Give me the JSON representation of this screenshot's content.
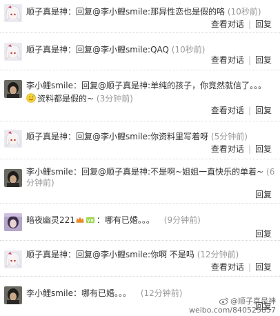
{
  "comments": [
    {
      "author": "顺子真是神",
      "sep": "：",
      "reply_prefix": "回复@李小鲤smile",
      "text": ":那异性恋也是假的咯",
      "time": "(10秒前)",
      "avatar": "anime-girl-avatar",
      "actions": {
        "view": "查看对话",
        "reply": "回复"
      }
    },
    {
      "author": "顺子真是神",
      "sep": "：",
      "reply_prefix": "回复@李小鲤smile",
      "text": ":QAQ",
      "time": "(10秒前)",
      "avatar": "anime-girl-avatar",
      "actions": {
        "view": "查看对话",
        "reply": "回复"
      }
    },
    {
      "author": "李小鲤smile",
      "sep": "：",
      "reply_prefix": "回复@顺子真是神",
      "text": ":单纯的孩子，你竟然就信了。。。",
      "text2": "资料都是假的~",
      "time": "(3分钟前)",
      "avatar": "dark-hair-avatar",
      "emoji": "sweat-smile-emoji",
      "actions": {
        "view": "查看对话",
        "reply": "回复"
      }
    },
    {
      "author": "顺子真是神",
      "sep": "：",
      "reply_prefix": "回复@李小鲤smile",
      "text": ":你资料里写着呀",
      "time": "(5分钟前)",
      "avatar": "anime-girl-avatar",
      "actions": {
        "view": "查看对话",
        "reply": "回复"
      }
    },
    {
      "author": "李小鲤smile",
      "sep": "：",
      "reply_prefix": "回复@顺子真是神",
      "text": ":不是啊~姐姐一直快乐的单着~",
      "time_line1": "(6",
      "time_line2": "分钟前)",
      "avatar": "dark-hair-avatar",
      "actions": {
        "reply": "回复"
      }
    },
    {
      "author": "暗夜幽灵221",
      "sep": "：",
      "text": "哪有已婚。。。",
      "time": "(9分钟前)",
      "avatar": "purple-avatar",
      "badges": [
        "member-crown-icon",
        "vip-badge-icon"
      ],
      "actions": {
        "reply": "回复"
      }
    },
    {
      "author": "顺子真是神",
      "sep": "：",
      "reply_prefix": "回复@李小鲤smile",
      "text": ":你啊 不是吗",
      "time": "(12分钟前)",
      "avatar": "anime-girl-avatar",
      "actions": {
        "view": "查看对话",
        "reply": "回复"
      }
    },
    {
      "author": "李小鲤smile",
      "sep": "：",
      "text": "哪有已婚。。。",
      "time": "(12分钟前)",
      "avatar": "dark-hair-avatar",
      "actions": {
        "reply": "回复"
      }
    }
  ],
  "watermark": {
    "handle": "@顺子真是神",
    "url": "weibo.com/840525857",
    "logo": "weibo-logo-icon"
  }
}
